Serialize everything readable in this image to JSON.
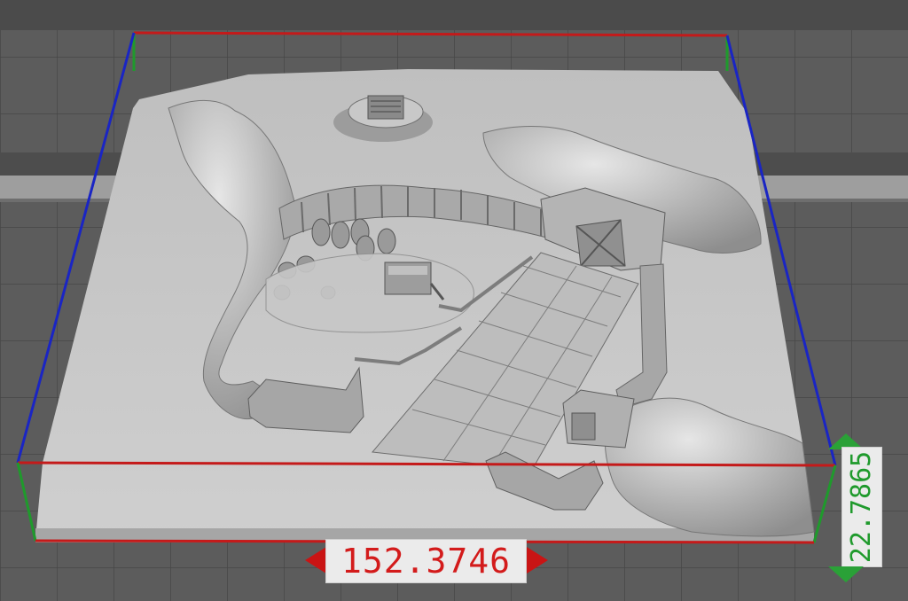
{
  "dimensions": {
    "width_value": "152.3746",
    "depth_value": "22.7865"
  },
  "colors": {
    "bounding_box_x": "#c41a1a",
    "bounding_box_z": "#1a25c4",
    "bounding_box_y": "#1f9a2c",
    "model_surface": "#b9b9b9",
    "grid_background": "#5a5a5a"
  }
}
